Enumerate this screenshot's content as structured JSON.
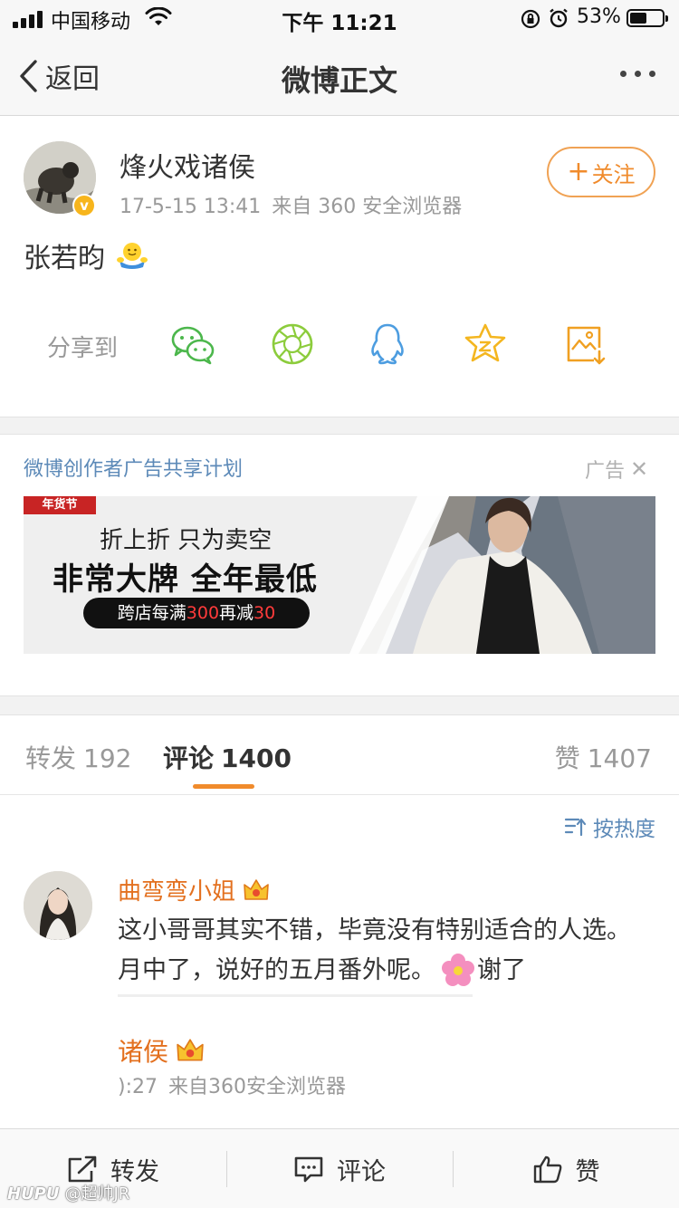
{
  "status_bar": {
    "carrier": "中国移动",
    "time": "下午 11:21",
    "battery_percent": "53%",
    "battery_level": 0.53
  },
  "nav": {
    "back_label": "返回",
    "title": "微博正文"
  },
  "post": {
    "author": "烽火戏诸侯",
    "date": "17-5-15 13:41",
    "source": "来自 360 安全浏览器",
    "follow_label": "关注",
    "text": "张若昀",
    "share_label": "分享到",
    "share_targets": [
      "wechat-icon",
      "moments-icon",
      "qq-icon",
      "qzone-icon",
      "save-image-icon"
    ]
  },
  "ad": {
    "program": "微博创作者广告共享计划",
    "tag": "广告",
    "badge": "年货节",
    "line1": "折上折 只为卖空",
    "line2": "非常大牌 全年最低",
    "pill_prefix": "跨店每满",
    "pill_amount1": "300",
    "pill_middle": "再减",
    "pill_amount2": "30"
  },
  "tabs": {
    "repost_label": "转发",
    "repost_count": "192",
    "comment_label": "评论",
    "comment_count": "1400",
    "like_label": "赞",
    "like_count": "1407"
  },
  "comments": {
    "sort_label": "按热度",
    "first": {
      "author": "曲弯弯小姐",
      "text_before": "这小哥哥其实不错，毕竟没有特别适合的人选。月中了，说好的五月番外呢。",
      "text_after": "谢了"
    },
    "reply": {
      "author_partial": "诸侯",
      "time_partial": "):27",
      "source": "来自360安全浏览器"
    }
  },
  "toolbar": {
    "repost": "转发",
    "comment": "评论",
    "like": "赞"
  },
  "watermark": {
    "brand": "HUPU",
    "handle": "@超帅JR"
  },
  "colors": {
    "accent_orange": "#f08b2c",
    "link_blue": "#5d8ab8",
    "name_orange": "#e3701f"
  }
}
